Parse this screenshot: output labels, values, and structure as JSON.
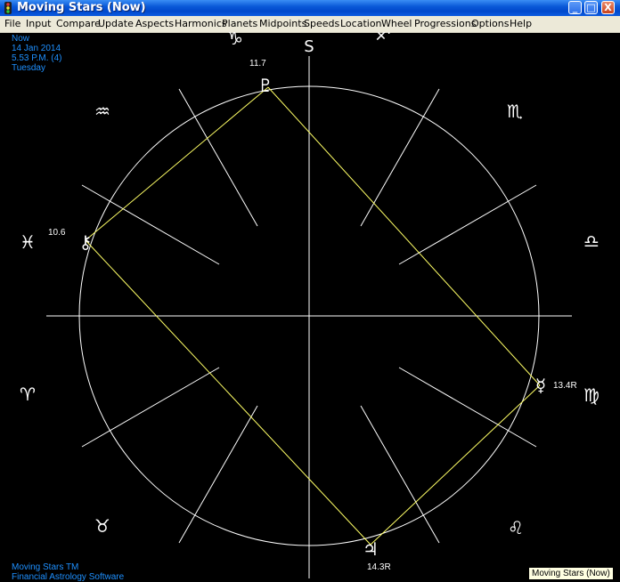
{
  "window": {
    "title": "Moving Stars (Now)",
    "buttons": {
      "minimize": "_",
      "maximize": "□",
      "close": "X"
    }
  },
  "menu": [
    "File",
    "Input",
    "Compare",
    "Update",
    "Aspects",
    "Harmonics",
    "Planets",
    "Midpoints",
    "Speeds",
    "Location",
    "Wheel",
    "Progressions",
    "Options",
    "Help"
  ],
  "info": {
    "line1": "Now",
    "line2": "14 Jan 2014",
    "line3": "5.53 P.M. (4)",
    "line4": "Tuesday"
  },
  "footer": {
    "line1": "Moving Stars TM",
    "line2": "Financial Astrology Software"
  },
  "wheel": {
    "top_label": "S",
    "signs": [
      {
        "name": "capricorn",
        "glyph": "♑"
      },
      {
        "name": "sagittarius",
        "glyph": "♐"
      },
      {
        "name": "scorpio",
        "glyph": "♏"
      },
      {
        "name": "libra",
        "glyph": "♎"
      },
      {
        "name": "virgo",
        "glyph": "♍"
      },
      {
        "name": "leo",
        "glyph": "♌"
      },
      {
        "name": "taurus",
        "glyph": "♉"
      },
      {
        "name": "aries",
        "glyph": "♈"
      },
      {
        "name": "pisces",
        "glyph": "♓"
      },
      {
        "name": "aquarius",
        "glyph": "♒"
      }
    ],
    "planets": [
      {
        "name": "pluto",
        "glyph": "♇",
        "degree": "11.7"
      },
      {
        "name": "chiron",
        "glyph": "⚷",
        "degree": "10.6"
      },
      {
        "name": "mercury",
        "glyph": "☿",
        "degree": "13.4R"
      },
      {
        "name": "jupiter",
        "glyph": "♃",
        "degree": "14.3R"
      }
    ],
    "colors": {
      "circle": "#ffffff",
      "aspect": "#ffff66",
      "text": "#ffffff",
      "info": "#1e90ff"
    }
  },
  "tooltip": "Moving Stars (Now)"
}
